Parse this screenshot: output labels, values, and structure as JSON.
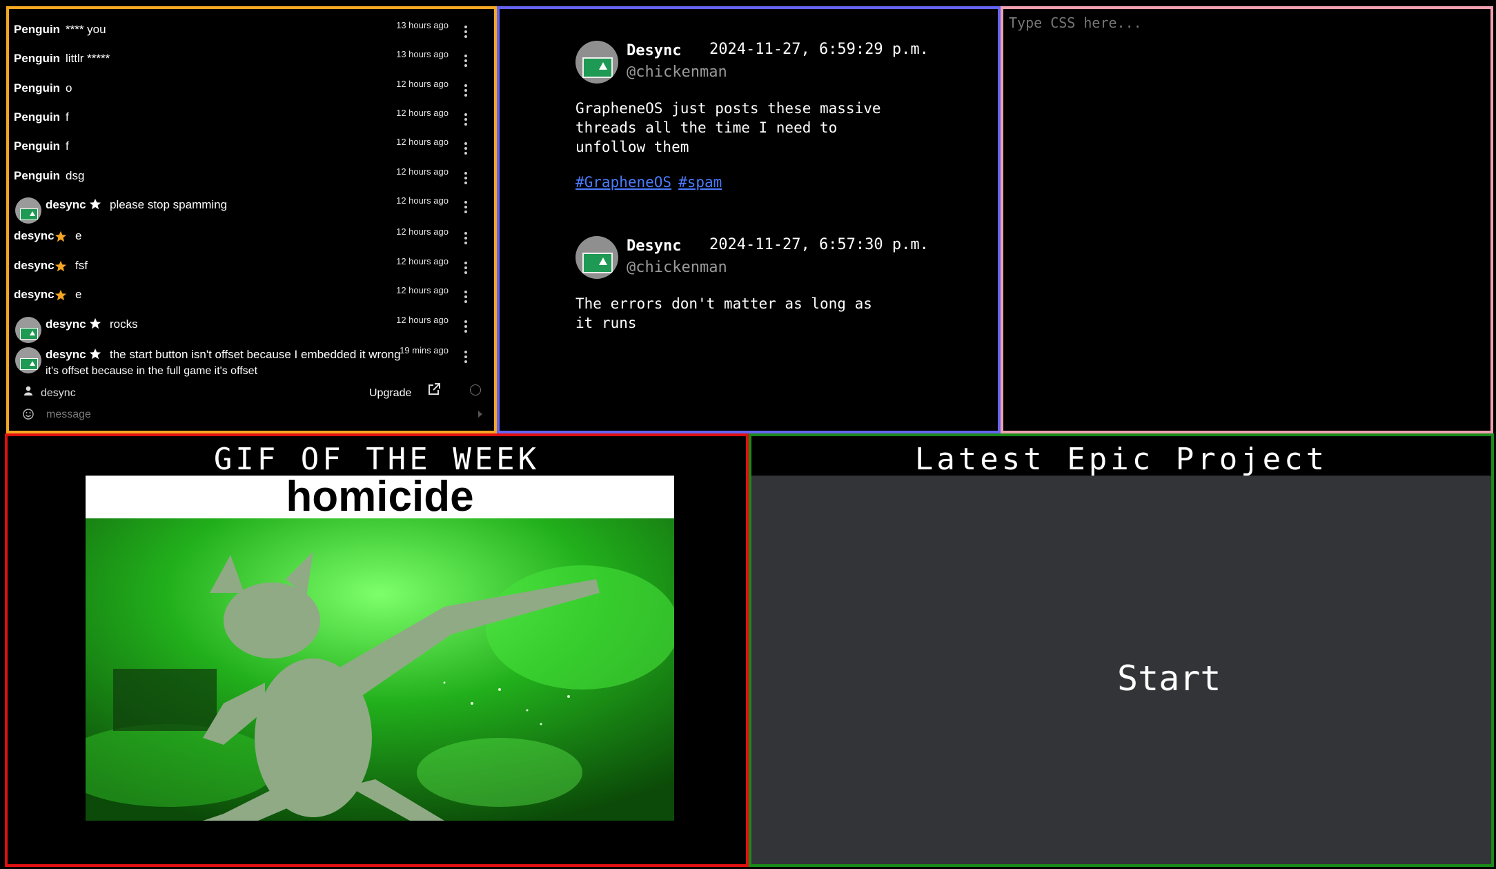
{
  "chat": {
    "messages": [
      {
        "name": "Penguin",
        "text": "**** you",
        "time": "13 hours ago",
        "avatar": false,
        "star": "none"
      },
      {
        "name": "Penguin",
        "text": "littlr *****",
        "time": "13 hours ago",
        "avatar": false,
        "star": "none"
      },
      {
        "name": "Penguin",
        "text": "o",
        "time": "12 hours ago",
        "avatar": false,
        "star": "none"
      },
      {
        "name": "Penguin",
        "text": "f",
        "time": "12 hours ago",
        "avatar": false,
        "star": "none"
      },
      {
        "name": "Penguin",
        "text": "f",
        "time": "12 hours ago",
        "avatar": false,
        "star": "none"
      },
      {
        "name": "Penguin",
        "text": "dsg",
        "time": "12 hours ago",
        "avatar": false,
        "star": "none"
      },
      {
        "name": "desync",
        "text": "please stop spamming",
        "time": "12 hours ago",
        "avatar": true,
        "star": "white"
      },
      {
        "name": "desync",
        "text": "e",
        "time": "12 hours ago",
        "avatar": false,
        "star": "gold"
      },
      {
        "name": "desync",
        "text": "fsf",
        "time": "12 hours ago",
        "avatar": false,
        "star": "gold"
      },
      {
        "name": "desync",
        "text": "e",
        "time": "12 hours ago",
        "avatar": false,
        "star": "gold"
      },
      {
        "name": "desync",
        "text": "rocks",
        "time": "12 hours ago",
        "avatar": true,
        "star": "white"
      },
      {
        "name": "desync",
        "text": "the start button isn't offset because I embedded it wrong",
        "text2": "it's offset because in the full game it's offset",
        "time": "19 mins ago",
        "avatar": true,
        "star": "white"
      }
    ],
    "footer": {
      "username": "desync",
      "upgrade_label": "Upgrade",
      "message_placeholder": "message"
    },
    "colors": {
      "star_gold": "#f5a623",
      "border": "#f5a623"
    }
  },
  "posts": [
    {
      "name": "Desync",
      "date": "2024-11-27, 6:59:29 p.m.",
      "handle": "@chickenman",
      "body": "GrapheneOS just posts these massive\nthreads all the time I need to\nunfollow them",
      "tags": [
        "#GrapheneOS",
        "#spam"
      ]
    },
    {
      "name": "Desync",
      "date": "2024-11-27, 6:57:30 p.m.",
      "handle": "@chickenman",
      "body": "The errors don't matter as long as\nit runs",
      "tags": []
    }
  ],
  "css_editor": {
    "placeholder": "Type CSS here..."
  },
  "gif_panel": {
    "title": "GIF OF THE WEEK",
    "caption": "homicide"
  },
  "project_panel": {
    "title": "Latest Epic Project",
    "start_label": "Start"
  }
}
